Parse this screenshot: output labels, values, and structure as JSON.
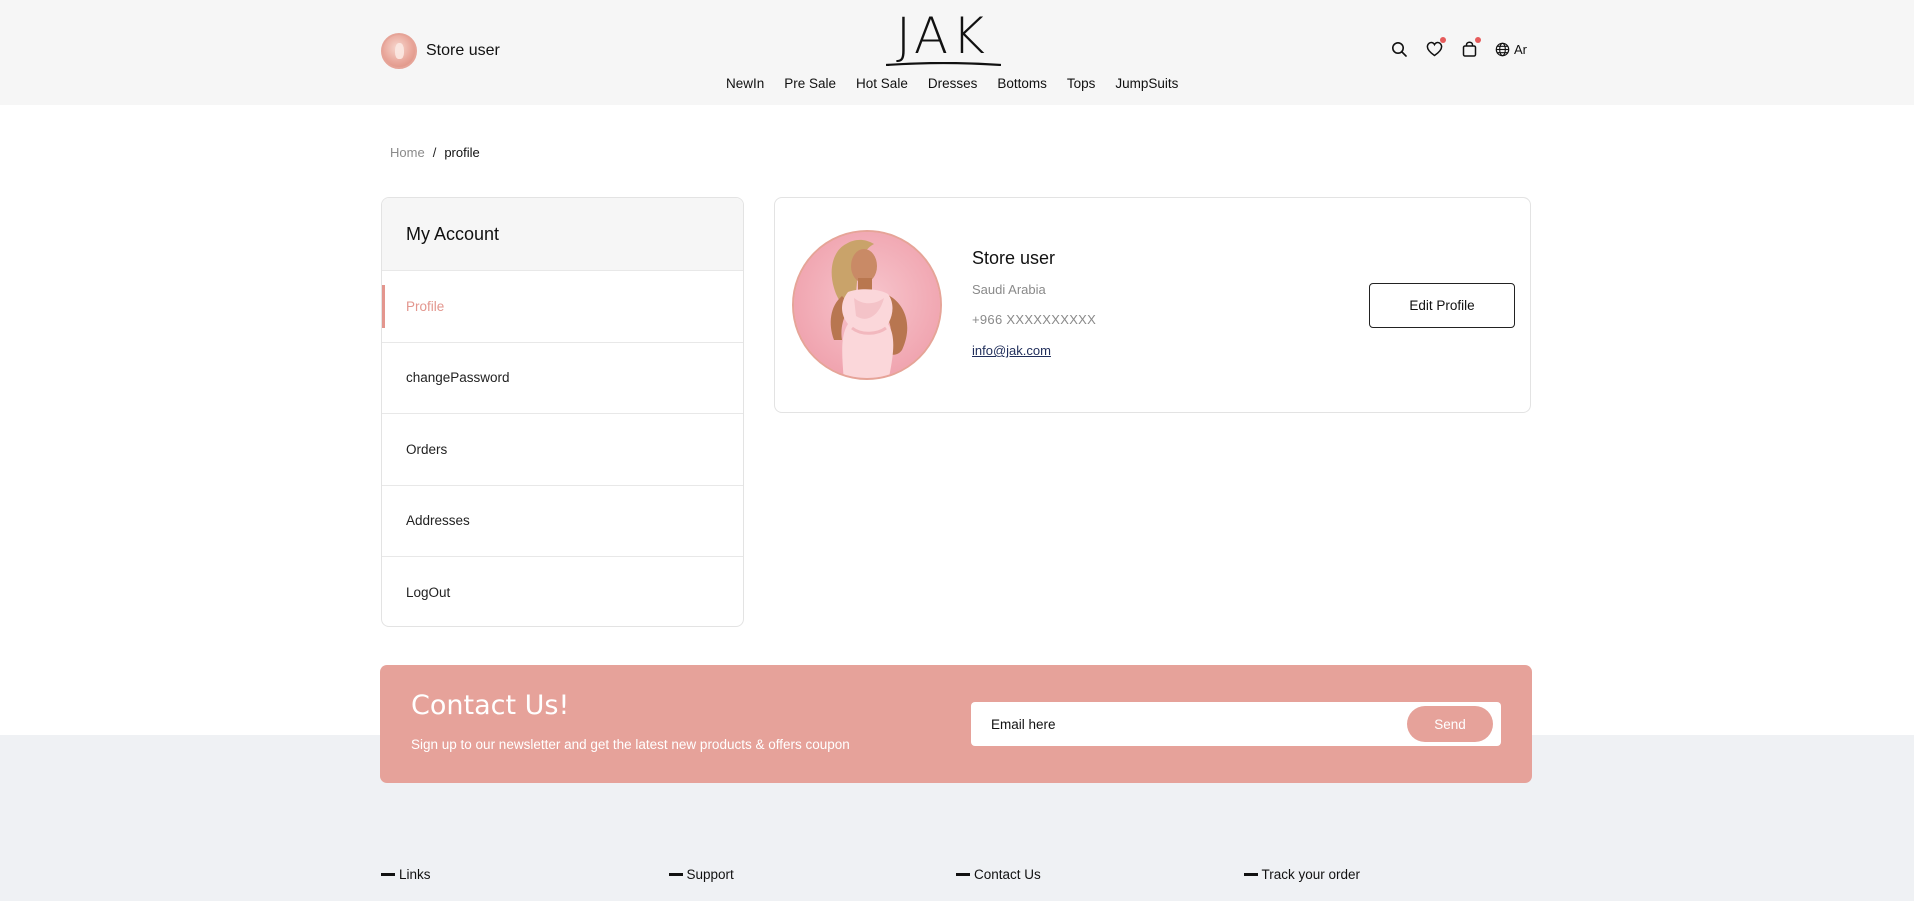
{
  "header": {
    "user_name": "Store user",
    "logo_text": "JAK",
    "nav": [
      "NewIn",
      "Pre Sale",
      "Hot Sale",
      "Dresses",
      "Bottoms",
      "Tops",
      "JumpSuits"
    ],
    "lang_label": "Ar",
    "icons": [
      "search-icon",
      "heart-icon",
      "bag-icon",
      "globe-icon"
    ]
  },
  "breadcrumb": {
    "home": "Home",
    "separator": "/",
    "current": "profile"
  },
  "sidebar": {
    "title": "My Account",
    "items": [
      "Profile",
      "changePassword",
      "Orders",
      "Addresses",
      "LogOut"
    ],
    "active_index": 0
  },
  "profile": {
    "name": "Store user",
    "country": "Saudi Arabia",
    "phone": "+966 XXXXXXXXXX",
    "email": "info@jak.com",
    "edit_label": "Edit Profile"
  },
  "contact": {
    "title": "Contact Us!",
    "subtitle": "Sign up to our newsletter and get the latest new products & offers coupon",
    "email_placeholder": "Email here",
    "send_label": "Send"
  },
  "footer": {
    "columns": [
      "Links",
      "Support",
      "Contact Us",
      "Track your order"
    ]
  },
  "colors": {
    "accent": "#e6a29a",
    "active_text": "#e3968e",
    "header_bg": "#f6f6f6",
    "footer_bg": "#eff1f4",
    "badge": "#e65b5b"
  }
}
